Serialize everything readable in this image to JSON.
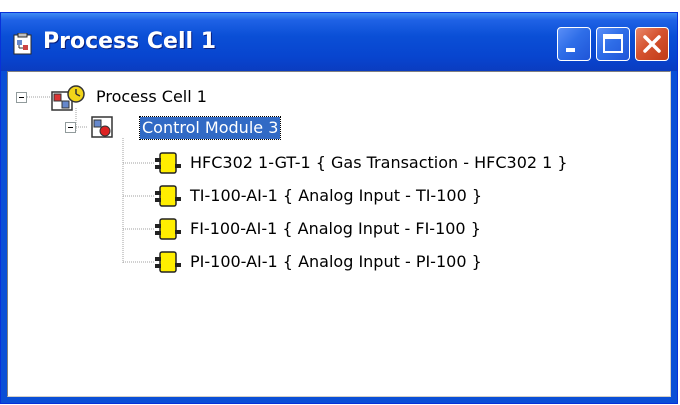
{
  "window": {
    "title": "Process Cell 1",
    "buttons": {
      "minimize": "minimize-icon",
      "maximize": "maximize-icon",
      "close": "close-icon"
    }
  },
  "tree": {
    "root": {
      "label": "Process Cell 1",
      "icon": "process-cell-icon",
      "expanded": true
    },
    "module": {
      "label": "Control Module 3",
      "icon": "control-module-icon",
      "expanded": true,
      "selected": true
    },
    "children": [
      {
        "label": "HFC302 1-GT-1 { Gas Transaction - HFC302 1 }",
        "icon": "function-block-icon"
      },
      {
        "label": "TI-100-AI-1 { Analog Input - TI-100 }",
        "icon": "function-block-icon"
      },
      {
        "label": "FI-100-AI-1 { Analog Input - FI-100 }",
        "icon": "function-block-icon"
      },
      {
        "label": "PI-100-AI-1 { Analog Input - PI-100 }",
        "icon": "function-block-icon"
      }
    ]
  },
  "colors": {
    "titlebar": "#0a4fd6",
    "selection": "#316ac5",
    "block_yellow": "#ffee00"
  }
}
